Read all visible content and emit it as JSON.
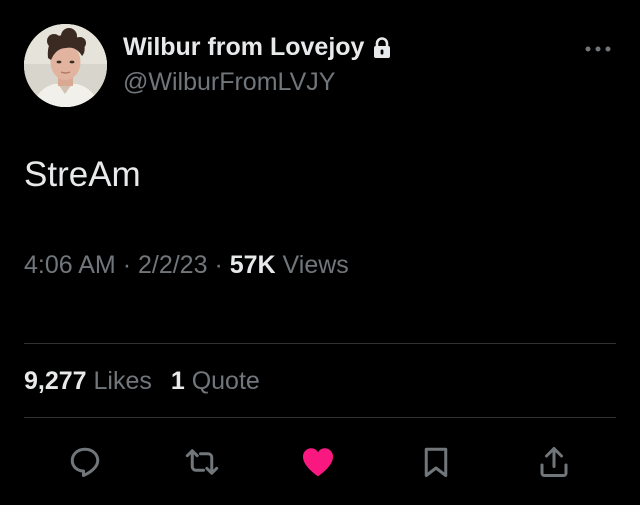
{
  "author": {
    "display_name": "Wilbur from Lovejoy",
    "handle": "@WilburFromLVJY",
    "protected": true,
    "avatar_icon": "profile-photo"
  },
  "tweet": {
    "text": "StreAm",
    "time": "4:06 AM",
    "date": "2/2/23",
    "separator": "·",
    "views_count": "57K",
    "views_label": "Views"
  },
  "stats": {
    "likes_count": "9,277",
    "likes_label": "Likes",
    "quotes_count": "1",
    "quotes_label": "Quote"
  },
  "actions": {
    "reply_icon": "reply-icon",
    "retweet_icon": "retweet-icon",
    "like_icon": "heart-icon",
    "bookmark_icon": "bookmark-icon",
    "share_icon": "share-icon",
    "liked": true
  },
  "colors": {
    "background": "#000000",
    "primary_text": "#e7e9ea",
    "secondary_text": "#71767b",
    "divider": "#2f3336",
    "like_pink": "#f91880"
  }
}
